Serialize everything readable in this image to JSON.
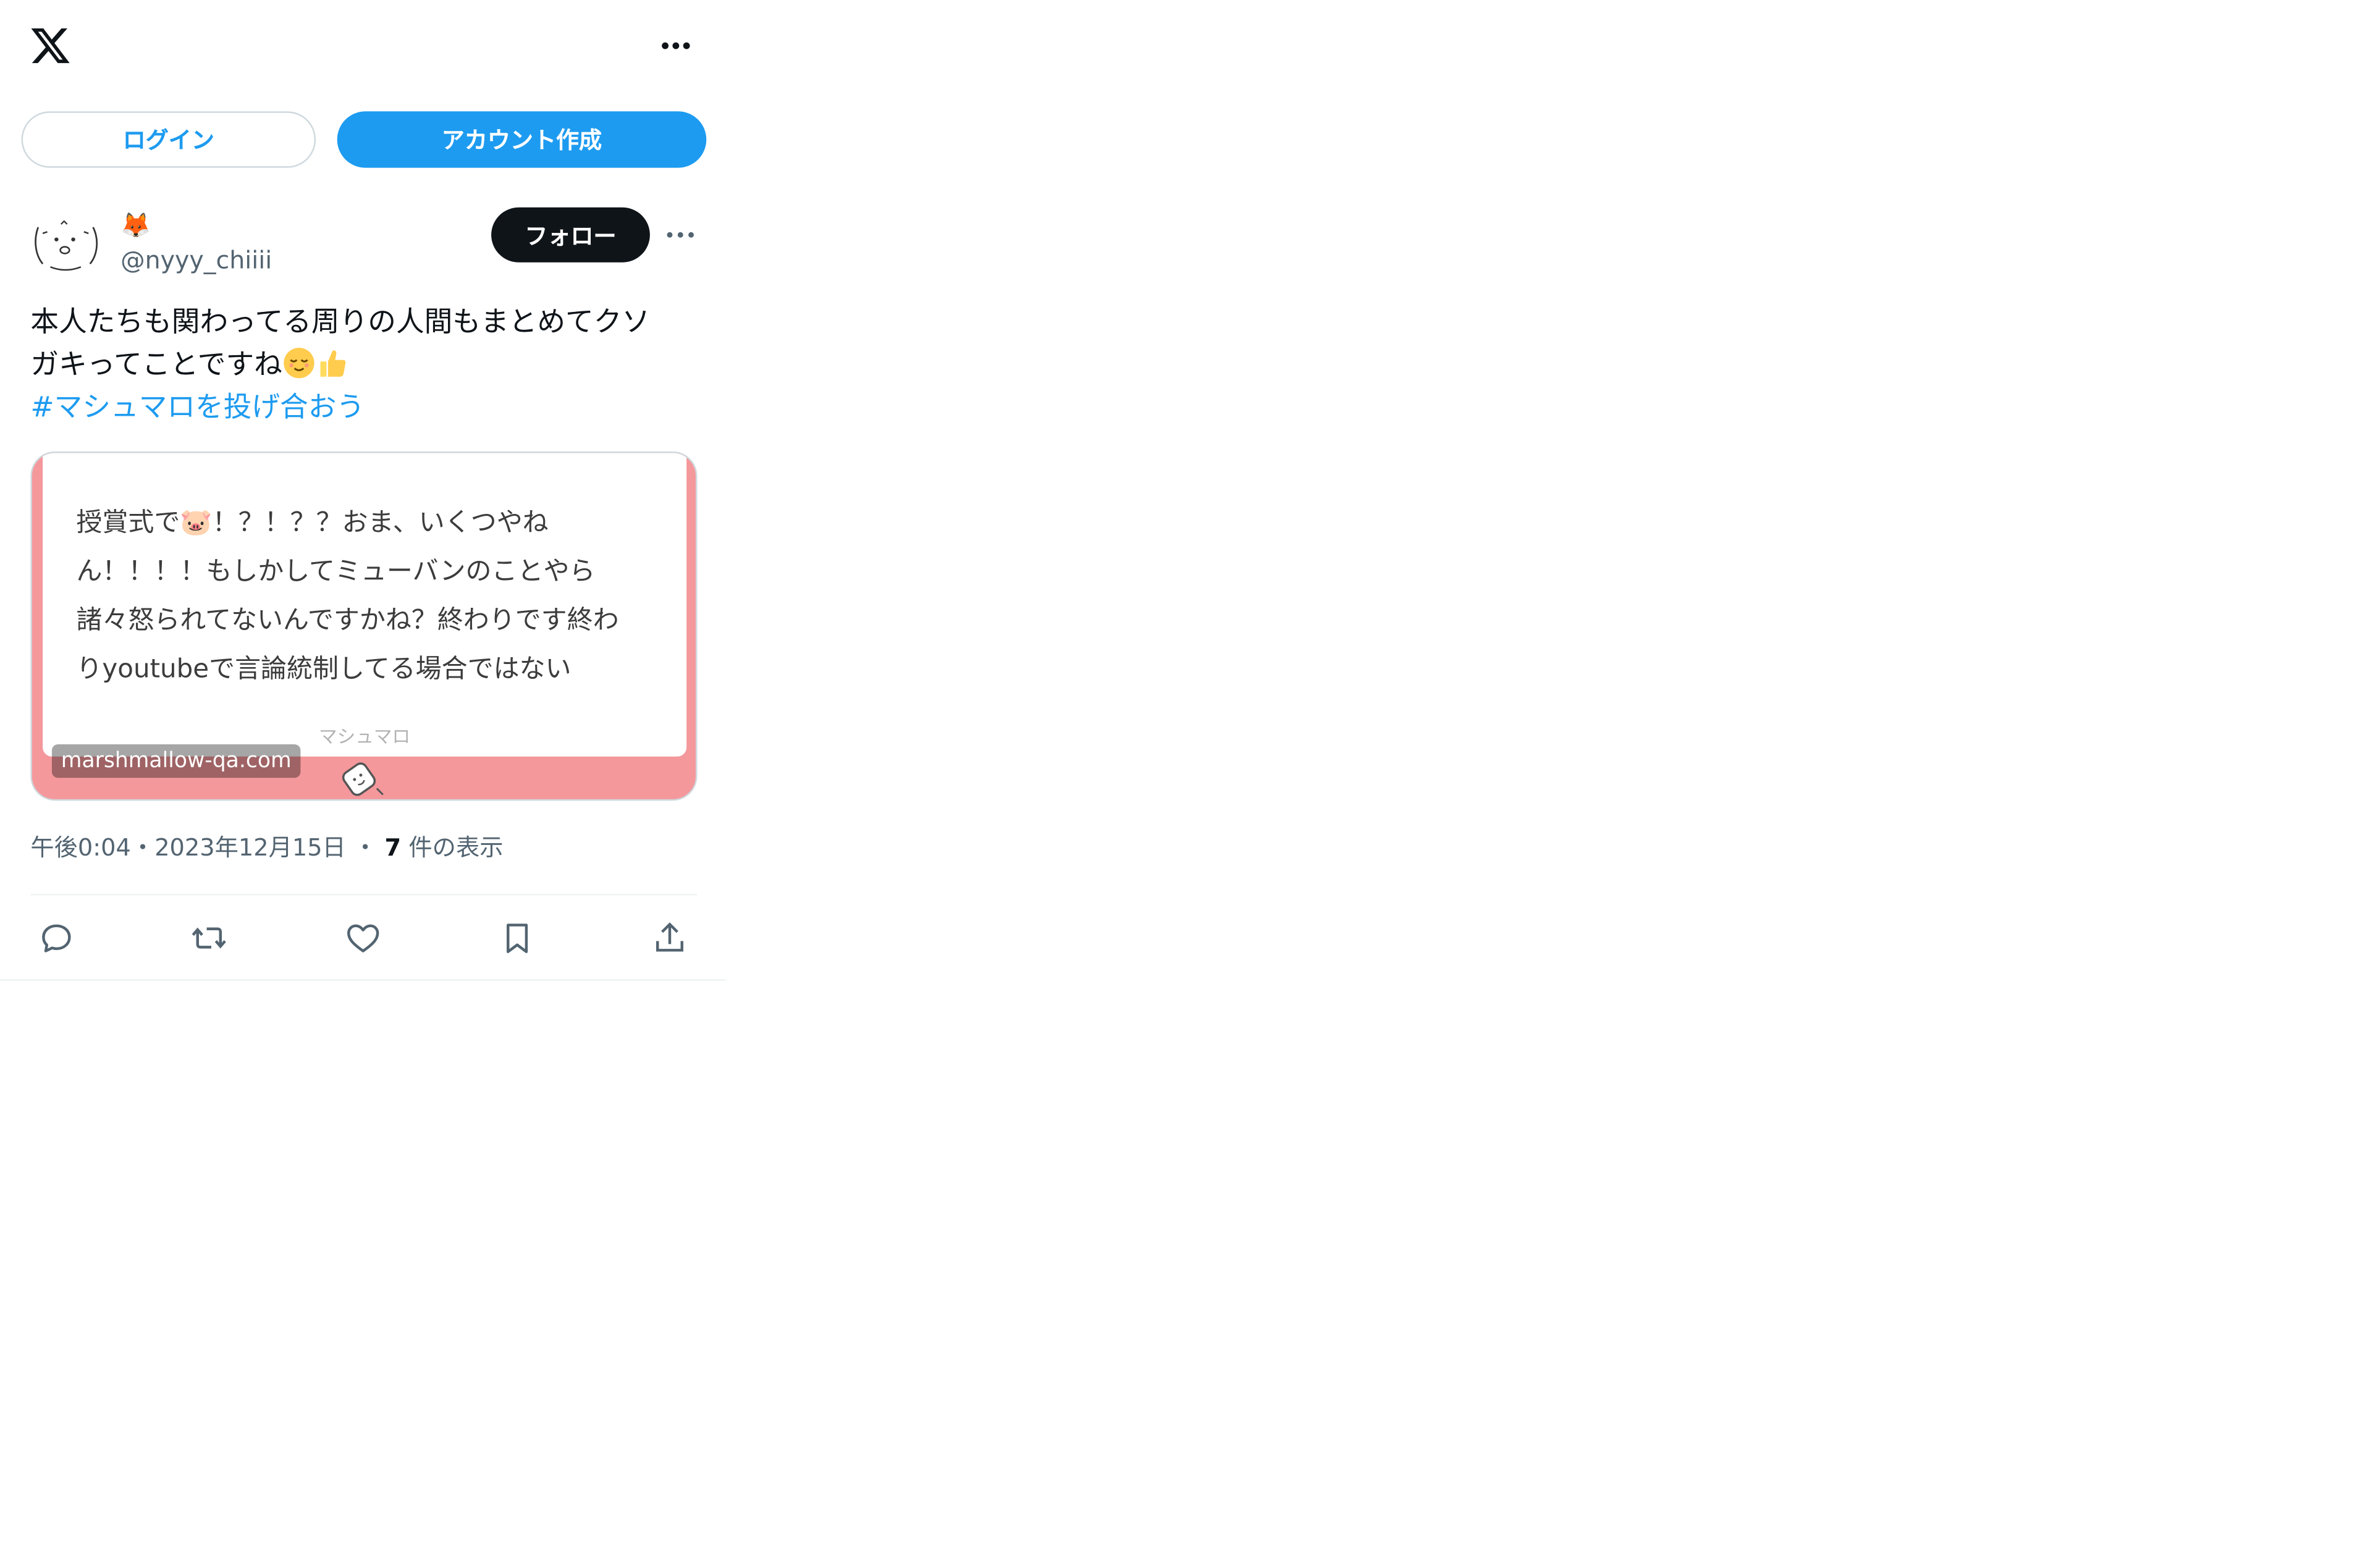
{
  "header": {
    "logo_icon": "x-logo-icon",
    "more_icon": "more-horizontal-icon"
  },
  "auth": {
    "login_label": "ログイン",
    "signup_label": "アカウント作成"
  },
  "tweet": {
    "author": {
      "display_name": "🦊",
      "handle": "@nyyy_chiiii",
      "avatar_icon": "avatar-doodle-face"
    },
    "follow_label": "フォロー",
    "text_lines": [
      "本人たちも関わってる周りの人間もまとめてクソ",
      "ガキってことですね"
    ],
    "hashtag": "#マシュマロを投げ合おう",
    "card": {
      "text_lines": [
        "授賞式で🐷！？！？？おま、いくつやね",
        "ん！！！！もしかしてミューバンのことやら",
        "諸々怒られてないんですかね？終わりです終わ",
        "りyoutubeで言論統制してる場合ではない"
      ],
      "brand": "マシュマロ",
      "domain": "marshmallow-qa.com"
    },
    "meta": {
      "time": "午後0:04",
      "separator": "・",
      "date": "2023年12月15日",
      "separator2": "・",
      "views_count": "7",
      "views_label": "件の表示"
    },
    "actions": [
      {
        "icon": "reply-icon"
      },
      {
        "icon": "retweet-icon"
      },
      {
        "icon": "like-icon"
      },
      {
        "icon": "bookmark-icon"
      },
      {
        "icon": "share-icon"
      }
    ]
  },
  "colors": {
    "accent": "#1d9bf0",
    "text": "#0f1419",
    "secondary": "#536471",
    "card_bg": "#f4989c"
  }
}
